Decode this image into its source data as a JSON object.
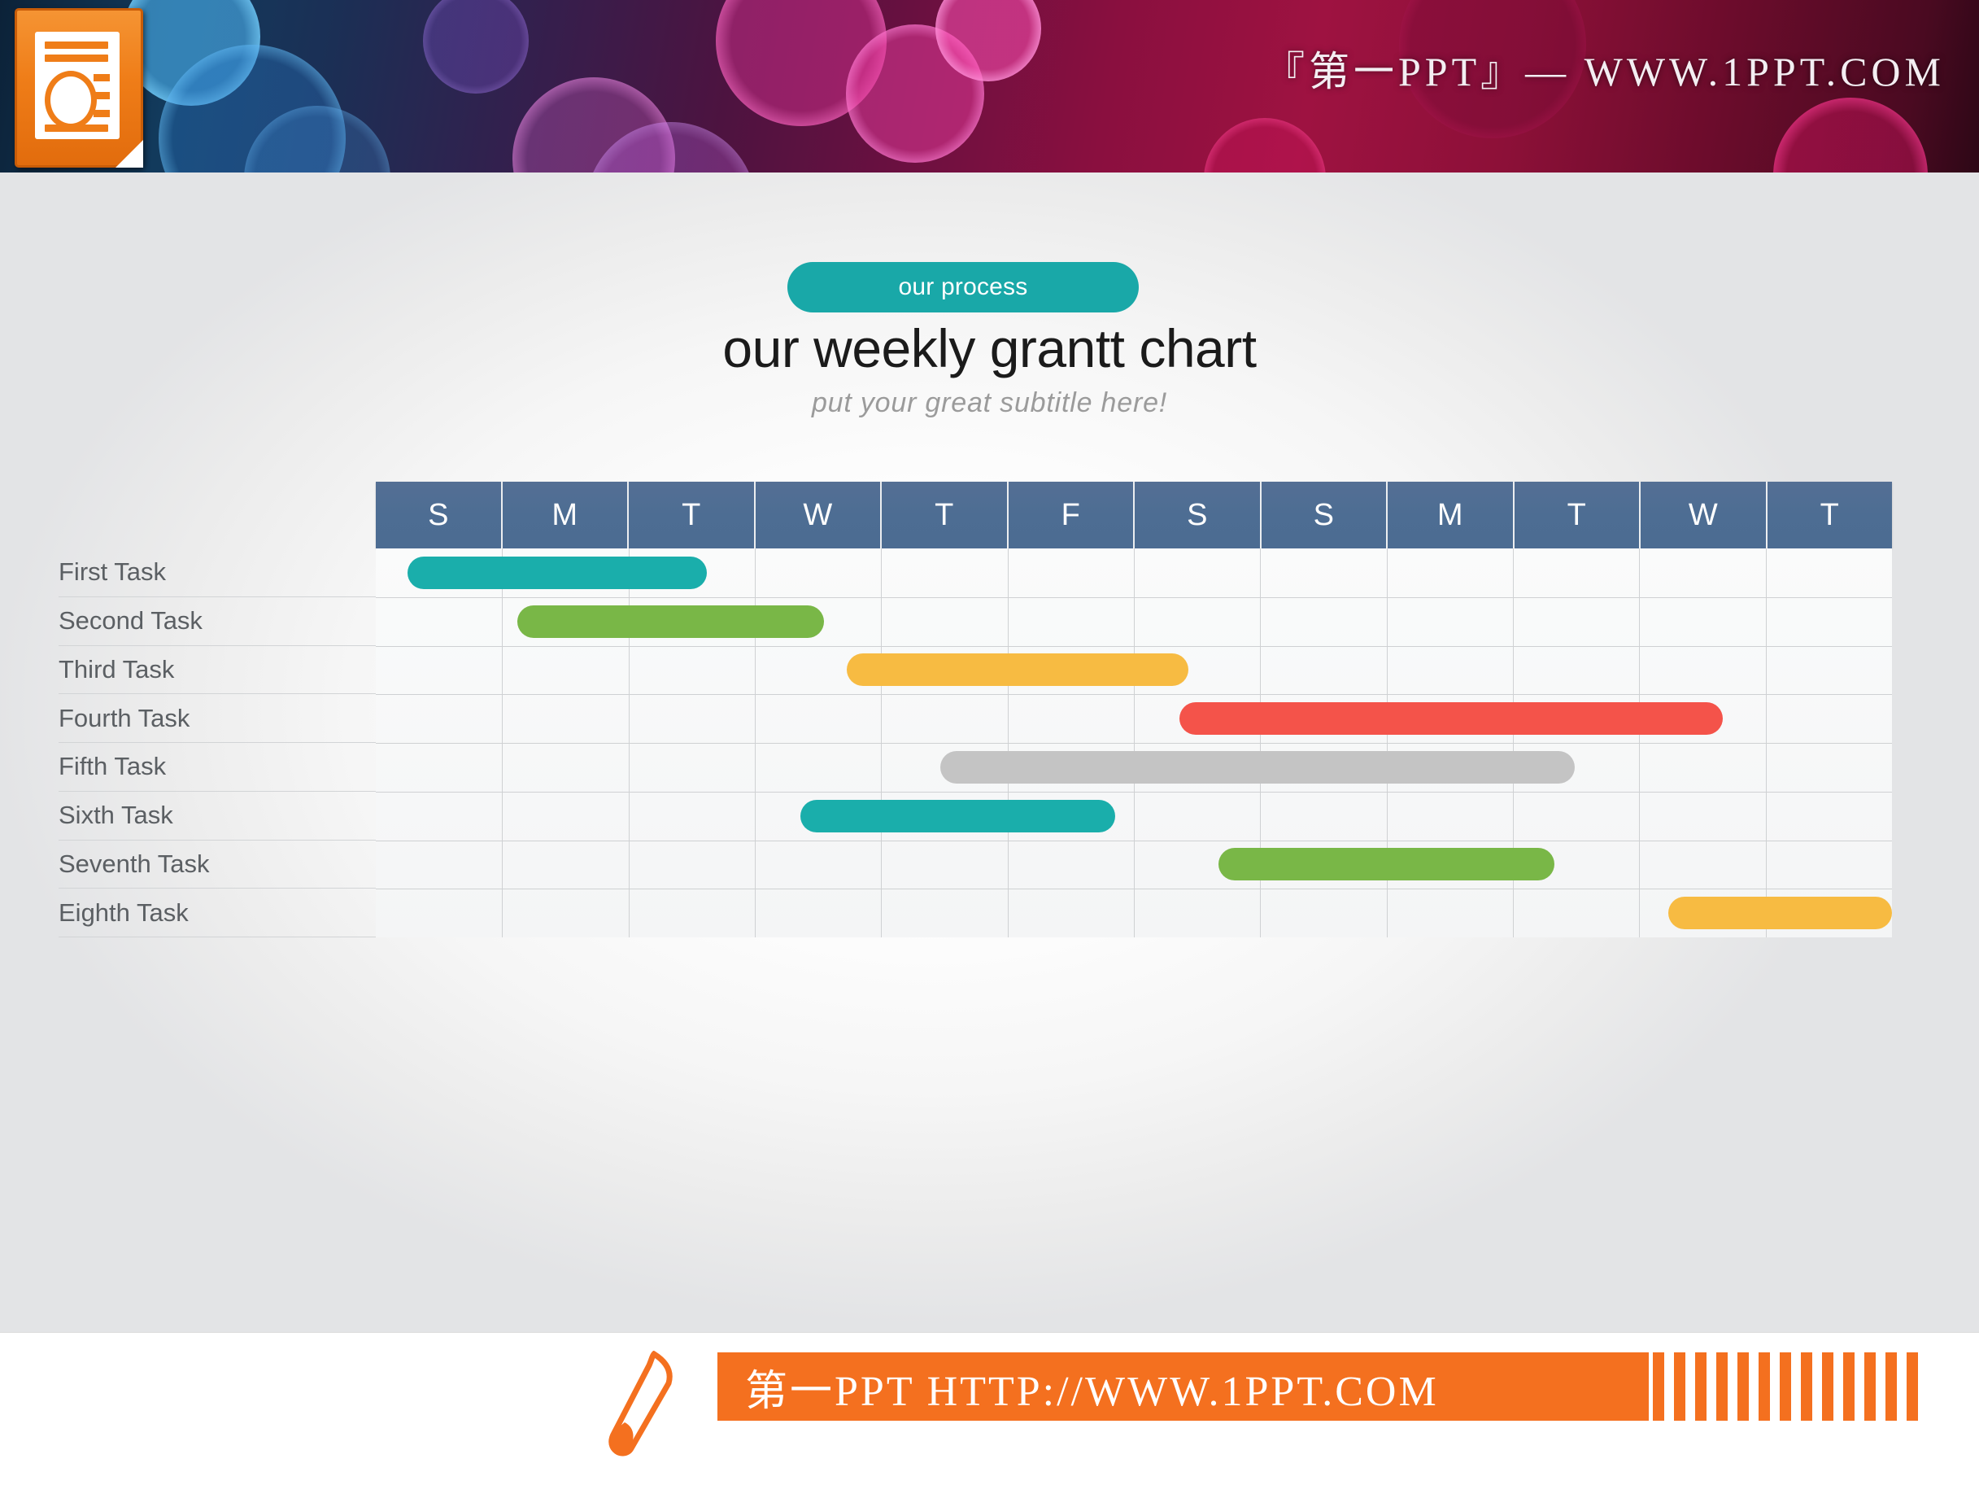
{
  "banner": {
    "caption": "『第一PPT』— WWW.1PPT.COM",
    "logo_icon": "powerpoint-file-icon"
  },
  "slide": {
    "badge_label": "our process",
    "title": "our weekly grantt chart",
    "subtitle": "put your great subtitle here!"
  },
  "footer": {
    "pencil_icon": "pencil-icon",
    "text": "第一PPT HTTP://WWW.1PPT.COM",
    "stripe_count": 13,
    "accent_color": "#f4701f"
  },
  "colors": {
    "teal": "#1aaeab",
    "green": "#79b747",
    "yellow": "#f7bb42",
    "red": "#f4534a",
    "gray": "#c4c4c4",
    "header_blue": "#4d6d93",
    "badge_teal": "#19a8a8"
  },
  "chart_data": {
    "type": "bar",
    "title": "our weekly grantt chart",
    "subtitle": "put your great subtitle here!",
    "xlabel": "",
    "ylabel": "",
    "grid": true,
    "legend": "none",
    "orientation": "horizontal",
    "columns": [
      "S",
      "M",
      "T",
      "W",
      "T",
      "F",
      "S",
      "S",
      "M",
      "T",
      "W",
      "T"
    ],
    "column_count": 12,
    "categories": [
      "First Task",
      "Second Task",
      "Third Task",
      "Fourth Task",
      "Fifth Task",
      "Sixth Task",
      "Seventh Task",
      "Eighth Task"
    ],
    "xlim": [
      0,
      12
    ],
    "tasks": [
      {
        "name": "First Task",
        "start": 0.25,
        "end": 2.62,
        "duration": 2.37,
        "color": "#1aaeab"
      },
      {
        "name": "Second Task",
        "start": 1.12,
        "end": 3.55,
        "duration": 2.43,
        "color": "#79b747"
      },
      {
        "name": "Third Task",
        "start": 3.73,
        "end": 6.43,
        "duration": 2.7,
        "color": "#f7bb42"
      },
      {
        "name": "Fourth Task",
        "start": 6.36,
        "end": 10.66,
        "duration": 4.3,
        "color": "#f4534a"
      },
      {
        "name": "Fifth Task",
        "start": 4.47,
        "end": 9.49,
        "duration": 5.02,
        "color": "#c4c4c4"
      },
      {
        "name": "Sixth Task",
        "start": 3.36,
        "end": 5.85,
        "duration": 2.49,
        "color": "#1aaeab"
      },
      {
        "name": "Seventh Task",
        "start": 6.67,
        "end": 9.33,
        "duration": 2.66,
        "color": "#79b747"
      },
      {
        "name": "Eighth Task",
        "start": 10.23,
        "end": 12.0,
        "duration": 1.77,
        "color": "#f7bb42"
      }
    ]
  }
}
